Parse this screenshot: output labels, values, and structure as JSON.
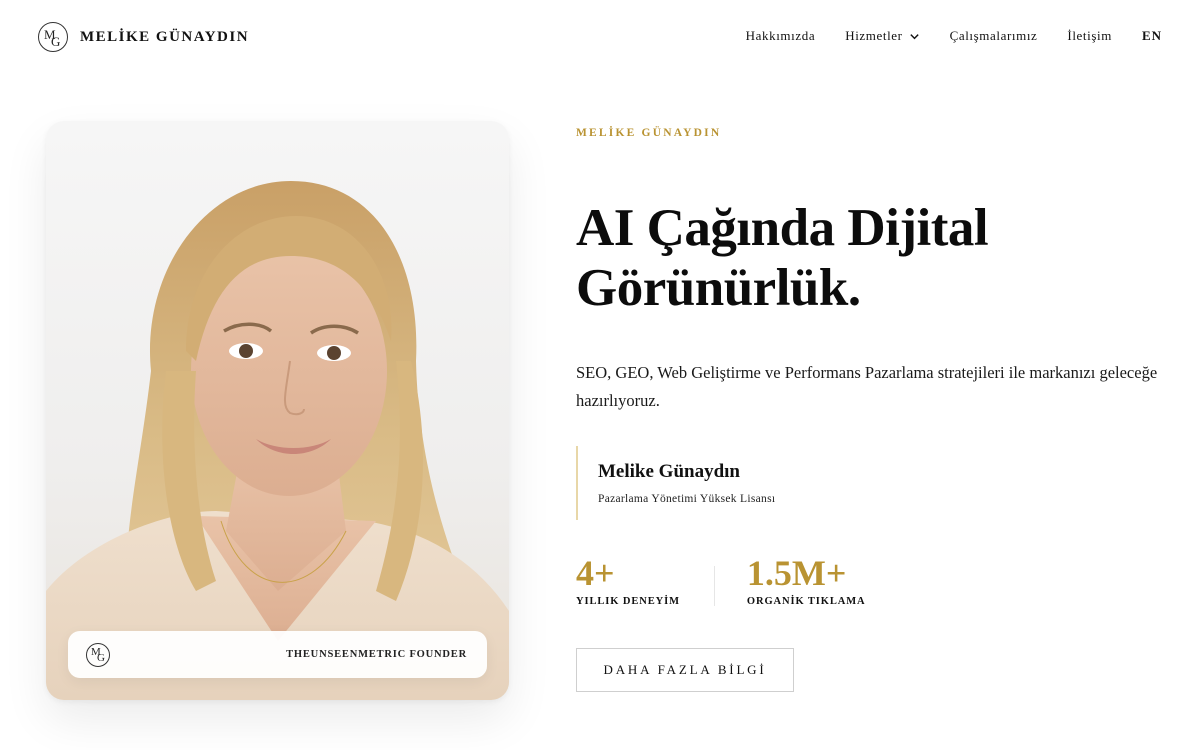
{
  "header": {
    "brand_name": "MELİKE GÜNAYDIN",
    "logo_letters": {
      "first": "M",
      "second": "G"
    },
    "nav": [
      {
        "label": "Hakkımızda"
      },
      {
        "label": "Hizmetler",
        "icon": "chevron-down-icon"
      },
      {
        "label": "Çalışmalarımız"
      },
      {
        "label": "İletişim"
      },
      {
        "label": "EN"
      }
    ]
  },
  "hero": {
    "eyebrow": "MELİKE GÜNAYDIN",
    "headline_line1": "AI Çağında Dijital",
    "headline_line2": "Görünürlük.",
    "description": "SEO, GEO, Web Geliştirme ve Performans Pazarlama stratejileri ile markanızı geleceğe hazırlıyoruz.",
    "profile": {
      "name": "Melike Günaydın",
      "title": "Pazarlama Yönetimi Yüksek Lisansı"
    },
    "stats": [
      {
        "value": "4+",
        "label": "YILLIK DENEYİM"
      },
      {
        "value": "1.5M+",
        "label": "ORGANİK TIKLAMA"
      }
    ],
    "cta_label": "DAHA FAZLA BİLGİ"
  },
  "photo_card": {
    "badge_text": "THEUNSEENMETRIC FOUNDER"
  },
  "colors": {
    "accent_gold": "#b99332",
    "quote_border": "#e8d7a8",
    "text": "#111111",
    "background": "#ffffff"
  }
}
